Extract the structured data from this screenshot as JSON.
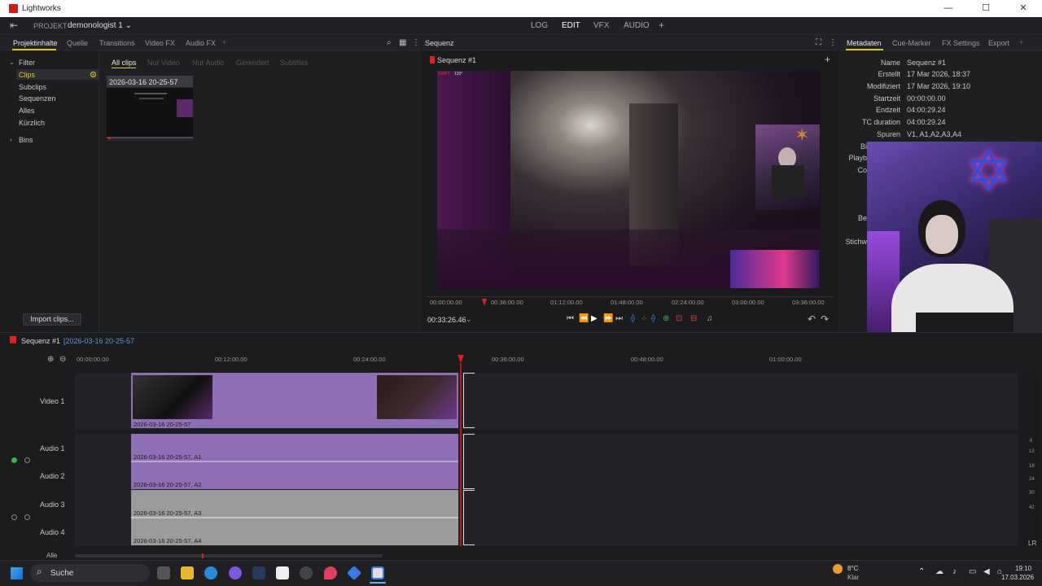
{
  "window": {
    "title": "Lightworks",
    "min": "—",
    "max": "☐",
    "close": "✕"
  },
  "project": {
    "label": "PROJEKT",
    "name": "demonologist 1 ⌄"
  },
  "topnav": [
    "LOG",
    "EDIT",
    "VFX",
    "AUDIO",
    "+"
  ],
  "left_tabs": [
    "Projektinhalte",
    "Quelle",
    "Transitions",
    "Video FX",
    "Audio FX",
    "+"
  ],
  "filter": {
    "header": "Filter",
    "items": [
      "Clips",
      "Subclips",
      "Sequenzen",
      "Alles",
      "Kürzlich"
    ],
    "bins": "Bins"
  },
  "clip_filters": [
    "All clips",
    "Nur Video",
    "Nur Audio",
    "Gerendert",
    "Subtitles"
  ],
  "clip_card": {
    "name": "2026-03-16 20-25-57"
  },
  "import_button": "Import clips...",
  "viewer": {
    "panel_title": "Sequenz",
    "seq_name": "Sequenz #1",
    "plus": "+",
    "ruler": [
      "00:00:00.00",
      "00:36:00.00",
      "01:12:00.00",
      "01:48:00.00",
      "02:24:00.00",
      "03:00:00.00",
      "03:36:00.00"
    ],
    "timecode": "00:33:26.46",
    "overlay_tl": "DRIFT",
    "overlay_tl2": "120°"
  },
  "right_tabs": [
    "Metadaten",
    "Cue-Marker",
    "FX Settings",
    "Export",
    "+"
  ],
  "metadata": [
    {
      "label": "Name",
      "value": "Sequenz #1"
    },
    {
      "label": "Erstellt",
      "value": "17 Mar 2026, 18:37"
    },
    {
      "label": "Modifiziert",
      "value": "17 Mar 2026, 19:10"
    },
    {
      "label": "Startzeit",
      "value": "00:00:00.00"
    },
    {
      "label": "Endzeit",
      "value": "04:00:29.24"
    },
    {
      "label": "TC duration",
      "value": "04:00:29.24"
    },
    {
      "label": "Spuren",
      "value": "V1, A1,A2,A3,A4"
    }
  ],
  "metadata_cut": [
    "Bi",
    "Playb",
    "Co",
    "Be",
    "Stichw"
  ],
  "timeline": {
    "seq_name": "Sequenz #1",
    "seq_source": "[2026-03-16 20-25-57",
    "ruler": [
      "00:00:00.00",
      "00:12:00.00",
      "00:24:00.00",
      "00:36:00.00",
      "00:48:00.00",
      "01:00:00.00"
    ],
    "tracks": [
      "Video 1",
      "Audio 1",
      "Audio 2",
      "Audio 3",
      "Audio 4"
    ],
    "clip_labels": [
      "2026-03-16 20-25-57",
      "2026-03-16 20-25-57, A1",
      "2026-03-16 20-25-57, A2",
      "2026-03-16 20-25-57, A3",
      "2026-03-16 20-25-57, A4"
    ],
    "all_label": "Alle",
    "meter_scale": [
      "6",
      "12",
      "18",
      "24",
      "30",
      "42"
    ],
    "lr": "LR"
  },
  "taskbar": {
    "search": "Suche",
    "weather_temp": "8°C",
    "weather_desc": "Klar",
    "time": "19:10",
    "date": "17.03.2026"
  },
  "colors": {
    "accent_red": "#e02020",
    "clip_purple": "#8e6fb5",
    "clip_gray": "#9b9b9b",
    "active_yellow": "#e6c619"
  }
}
